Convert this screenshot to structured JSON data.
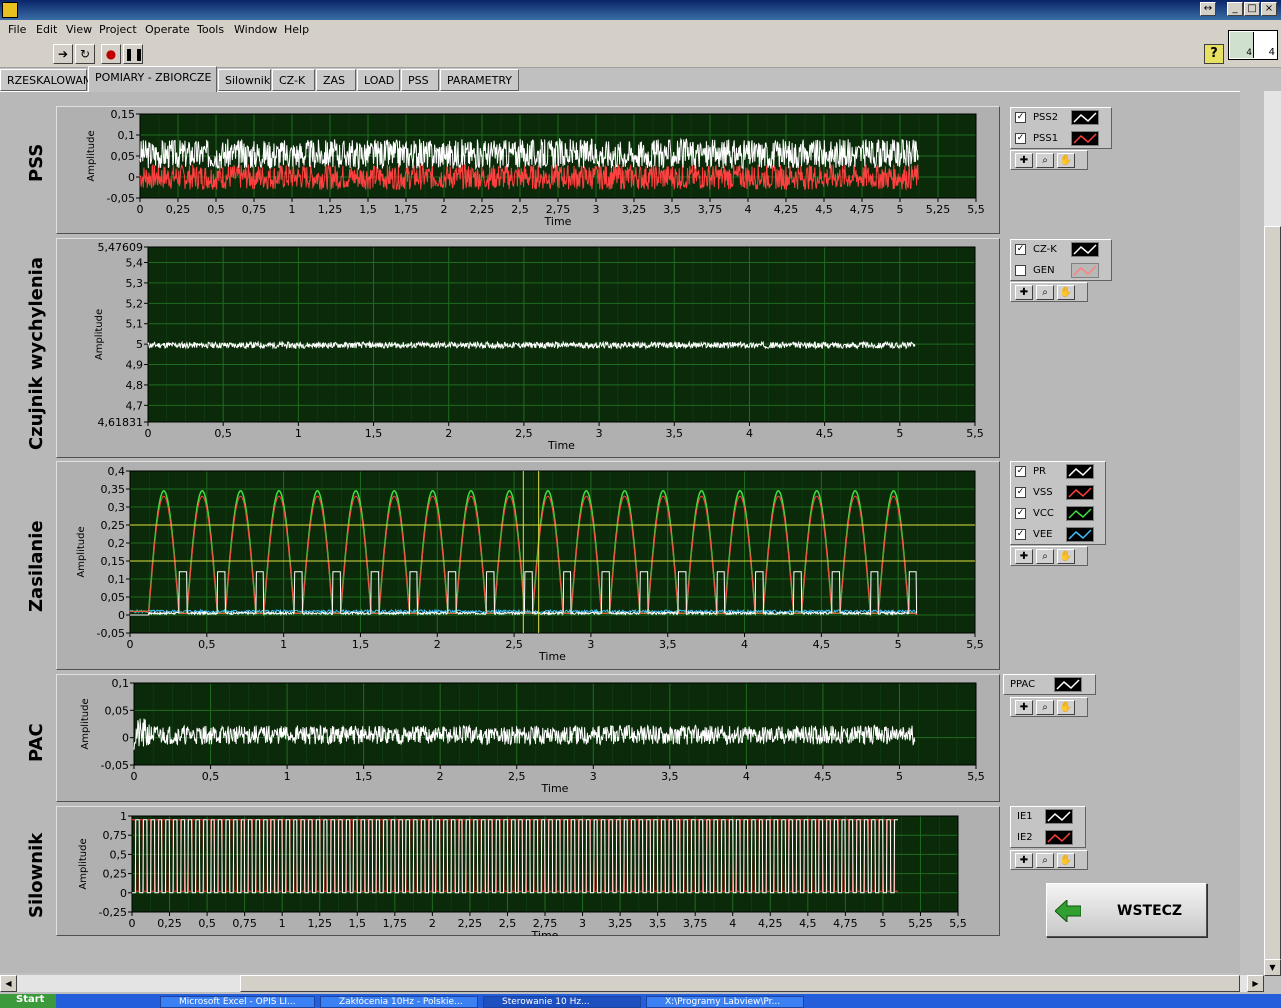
{
  "menu": [
    "File",
    "Edit",
    "View",
    "Project",
    "Operate",
    "Tools",
    "Window",
    "Help"
  ],
  "vi_icon": {
    "left": "4",
    "right": "4"
  },
  "tabs": [
    {
      "label": "RZESKALOWANE"
    },
    {
      "label": "POMIARY - ZBIORCZE",
      "active": true
    },
    {
      "label": "Silownik"
    },
    {
      "label": "CZ-K"
    },
    {
      "label": "ZAS"
    },
    {
      "label": "LOAD"
    },
    {
      "label": "PSS"
    },
    {
      "label": "PARAMETRY"
    }
  ],
  "graphs": {
    "pss": {
      "title": "PSS",
      "ylabel": "Amplitude",
      "xlabel": "Time",
      "yticks": [
        "0,15",
        "0,1",
        "0,05",
        "0",
        "-0,05"
      ],
      "xticks": [
        "0",
        "0,25",
        "0,5",
        "0,75",
        "1",
        "1,25",
        "1,5",
        "1,75",
        "2",
        "2,25",
        "2,5",
        "2,75",
        "3",
        "3,25",
        "3,5",
        "3,75",
        "4",
        "4,25",
        "4,5",
        "4,75",
        "5",
        "5,25",
        "5,5"
      ],
      "legend": [
        {
          "name": "PSS2",
          "checked": true,
          "color": "#ffffff"
        },
        {
          "name": "PSS1",
          "checked": true,
          "color": "#ff4040"
        }
      ]
    },
    "czk": {
      "title": "Czujnik wychylenia",
      "ylabel": "Amplitude",
      "xlabel": "Time",
      "yticks": [
        "5,47609",
        "5,4",
        "5,3",
        "5,2",
        "5,1",
        "5",
        "4,9",
        "4,8",
        "4,7",
        "4,61831"
      ],
      "xticks": [
        "0",
        "0,5",
        "1",
        "1,5",
        "2",
        "2,5",
        "3",
        "3,5",
        "4",
        "4,5",
        "5",
        "5,5"
      ],
      "legend": [
        {
          "name": "CZ-K",
          "checked": true,
          "color": "#ffffff"
        },
        {
          "name": "GEN",
          "checked": false,
          "color": "#ff8080"
        }
      ]
    },
    "zas": {
      "title": "Zasilanie",
      "ylabel": "Amplitude",
      "xlabel": "Time",
      "yticks": [
        "0,4",
        "0,35",
        "0,3",
        "0,25",
        "0,2",
        "0,15",
        "0,1",
        "0,05",
        "0",
        "-0,05"
      ],
      "xticks": [
        "0",
        "0,5",
        "1",
        "1,5",
        "2",
        "2,5",
        "3",
        "3,5",
        "4",
        "4,5",
        "5",
        "5,5"
      ],
      "legend": [
        {
          "name": "PR",
          "checked": true,
          "color": "#ffffff"
        },
        {
          "name": "VSS",
          "checked": true,
          "color": "#ff4040"
        },
        {
          "name": "VCC",
          "checked": true,
          "color": "#40e040"
        },
        {
          "name": "VEE",
          "checked": true,
          "color": "#40c0ff"
        }
      ]
    },
    "pac": {
      "title": "PAC",
      "ylabel": "Amplitude",
      "xlabel": "Time",
      "yticks": [
        "0,1",
        "0,05",
        "0",
        "-0,05"
      ],
      "xticks": [
        "0",
        "0,5",
        "1",
        "1,5",
        "2",
        "2,5",
        "3",
        "3,5",
        "4",
        "4,5",
        "5",
        "5,5"
      ],
      "legend": [
        {
          "name": "PPAC",
          "checked": null,
          "color": "#ffffff"
        }
      ]
    },
    "sil": {
      "title": "Silownik",
      "ylabel": "Amplitude",
      "xlabel": "Time",
      "yticks": [
        "1",
        "0,75",
        "0,5",
        "0,25",
        "0",
        "-0,25"
      ],
      "xticks": [
        "0",
        "0,25",
        "0,5",
        "0,75",
        "1",
        "1,25",
        "1,5",
        "1,75",
        "2",
        "2,25",
        "2,5",
        "2,75",
        "3",
        "3,25",
        "3,5",
        "3,75",
        "4",
        "4,25",
        "4,5",
        "4,75",
        "5",
        "5,25",
        "5,5"
      ],
      "legend": [
        {
          "name": "IE1",
          "checked": null,
          "color": "#ffffff"
        },
        {
          "name": "IE2",
          "checked": null,
          "color": "#ff4040"
        }
      ]
    }
  },
  "button_label": "WSTECZ",
  "taskbar": {
    "start": "Start",
    "items": [
      "Microsoft Excel - OPIS LI...",
      "Zakłócenia 10Hz - Polskie...",
      "Sterowanie 10 Hz...",
      "X:\\Programy Labview\\Pr..."
    ]
  },
  "colors": {
    "plot_bg": "#0a2a0a",
    "grid": "#1f6b1f",
    "accent_green": "#40e040",
    "accent_red": "#ff4040"
  }
}
